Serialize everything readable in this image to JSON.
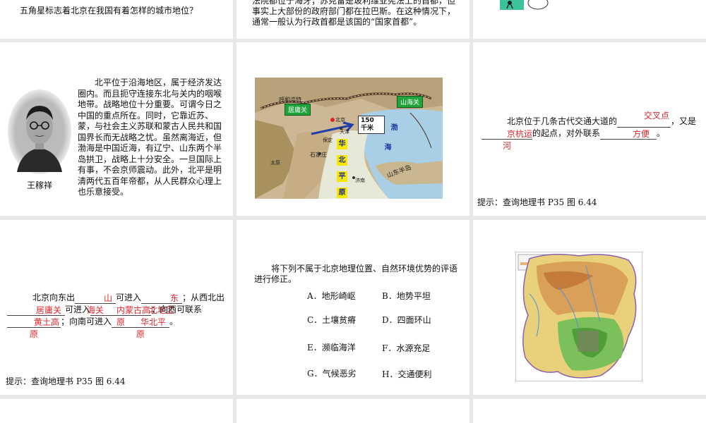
{
  "r1": {
    "left_question": "五角星标志着北京在我国有着怎样的城市地位？",
    "mid_text": "法院都位于海牙；苏克雷是玻利维亚宪法上的首都，但事实上大部份的政府部门都在拉巴斯。在这种情况下，通常一般认为行政首都是该国的“国家首都”。"
  },
  "r2": {
    "quote": "北平位于沿海地区，属于经济发达圈内。而且扼守连接东北与关内的咽喉地带。战略地位十分重要。可谓今日之中国的重点所在。同时，它靠近苏、蒙，与社会主义苏联和蒙古人民共和国国界长而无战略之忧。虽然离海近，但渤海是中国近海，有辽宁、山东两个半岛拱卫，战略上十分安全。一旦国际上有事，不会京师震动。此外，北平是明清两代五百年帝都，从人民群众心理上也乐意接受。",
    "portrait_name": "王稼祥",
    "map": {
      "juyongguan": "居庸关",
      "shanhaiguan": "山海关",
      "distance": "150 千米",
      "bo": "渤",
      "hai": "海",
      "huabei": [
        "华",
        "北",
        "平",
        "原"
      ],
      "shandong": "山东半岛",
      "huhehaote": "呼和浩特",
      "beijing": "北京",
      "tianjin": "天津",
      "shijiazhuang": "石家庄",
      "jinan": "济南",
      "taiyuan": "太原",
      "baoding": "保定"
    },
    "q_prefix": "北京位于几条古代交通大道的",
    "q_mid1": "，又是",
    "q_mid2": "的起点，对外联系",
    "q_end": "。",
    "ans1": "交叉点",
    "ans2": "京杭运河",
    "ans3": "方便",
    "hint": "提示：查询地理书 P35 图 6.44"
  },
  "r3": {
    "p1": "北京向东出",
    "a1": "山海关",
    "p2": "可进入",
    "a2": "东北地区",
    "p3": "；从西北出",
    "a3": "居庸关",
    "p4": "可进入",
    "a4": "内蒙古高原",
    "p5": "；向西可联系",
    "a5": "黄土高原",
    "p6": "；向南可进入",
    "a6": "华北平原",
    "p7": "。",
    "hint": "提示：查询地理书 P35 图 6.44",
    "question": "将下列不属于北京地理位置、自然环境优势的评语进行修正。",
    "options": [
      "A．地形崎岖",
      "B．地势平坦",
      "C．土壤贫瘠",
      "D．四面环山",
      "E．濒临海洋",
      "F．水源充足",
      "G．气候恶劣",
      "H．交通便利"
    ]
  },
  "colors": {
    "answer_red": "#d8262c",
    "sea_blue": "#a9cfe6",
    "plain_green": "#59b44b"
  }
}
